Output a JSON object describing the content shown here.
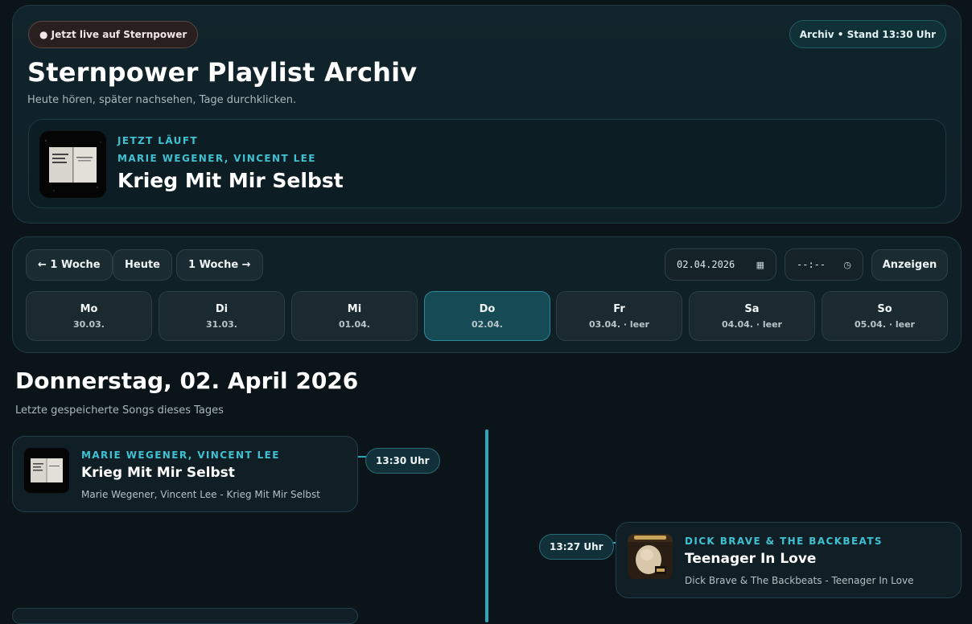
{
  "hero": {
    "live_pill": "● Jetzt live auf Sternpower",
    "archive_pill": "Archiv • Stand 13:30 Uhr",
    "title": "Sternpower Playlist Archiv",
    "subtitle": "Heute hören, später nachsehen, Tage durchklicken.",
    "now_playing": {
      "label": "JETZT LÄUFT",
      "artist": "MARIE WEGENER, VINCENT LEE",
      "title": "Krieg Mit Mir Selbst"
    }
  },
  "nav": {
    "prev_week": "← 1 Woche",
    "today": "Heute",
    "next_week": "1 Woche →",
    "date_value": "02.04.2026",
    "time_value": "--:--",
    "show_button": "Anzeigen",
    "days": [
      {
        "name": "Mo",
        "date": "30.03."
      },
      {
        "name": "Di",
        "date": "31.03."
      },
      {
        "name": "Mi",
        "date": "01.04."
      },
      {
        "name": "Do",
        "date": "02.04."
      },
      {
        "name": "Fr",
        "date": "03.04. · leer"
      },
      {
        "name": "Sa",
        "date": "04.04. · leer"
      },
      {
        "name": "So",
        "date": "05.04. · leer"
      }
    ],
    "active_day": "Do"
  },
  "day_view": {
    "heading": "Donnerstag, 02. April 2026",
    "subtitle": "Letzte gespeicherte Songs dieses Tages",
    "tracks": [
      {
        "time": "13:30 Uhr",
        "artist": "MARIE WEGENER, VINCENT LEE",
        "title": "Krieg Mit Mir Selbst",
        "desc": "Marie Wegener, Vincent Lee - Krieg Mit Mir Selbst"
      },
      {
        "time": "13:27 Uhr",
        "artist": "DICK BRAVE & THE BACKBEATS",
        "title": "Teenager In Love",
        "desc": "Dick Brave & The Backbeats - Teenager In Love"
      }
    ]
  },
  "colors": {
    "background": "#0a1419",
    "accent": "#3fc1d2",
    "active_day": "#164a55"
  }
}
